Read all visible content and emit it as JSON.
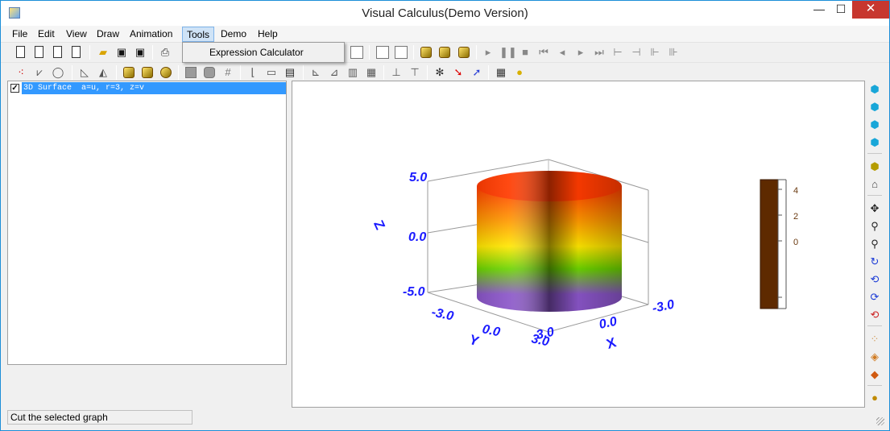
{
  "window": {
    "title": "Visual Calculus(Demo Version)"
  },
  "window_buttons": {
    "minimize": "—",
    "maximize": "☐",
    "close": "✕"
  },
  "menu": {
    "items": [
      "File",
      "Edit",
      "View",
      "Draw",
      "Animation",
      "Tools",
      "Demo",
      "Help"
    ],
    "open_menu": "Tools",
    "dropdown_items": [
      "Expression Calculator"
    ]
  },
  "graph_list": {
    "items": [
      {
        "checked": true,
        "label": "3D Surface  a=u, r=3, z=v"
      }
    ]
  },
  "plot": {
    "z_axis_label": "Z",
    "y_axis_label": "Y",
    "x_axis_label": "X",
    "z_ticks": [
      "5.0",
      "0.0",
      "-5.0"
    ],
    "y_ticks": [
      "-3.0",
      "0.0",
      "3.0"
    ],
    "x_ticks": [
      "-3.0",
      "0.0",
      "3.0"
    ],
    "colorbar_ticks": [
      "4",
      "2",
      "0"
    ],
    "surface_colors": [
      "#ff3b00",
      "#ff9a00",
      "#ffe600",
      "#6bd400",
      "#8a55c8"
    ],
    "colorbar_color": "#5e2a00",
    "axis_label_color": "#1b1bff"
  },
  "status": {
    "text": "Cut the selected graph"
  }
}
